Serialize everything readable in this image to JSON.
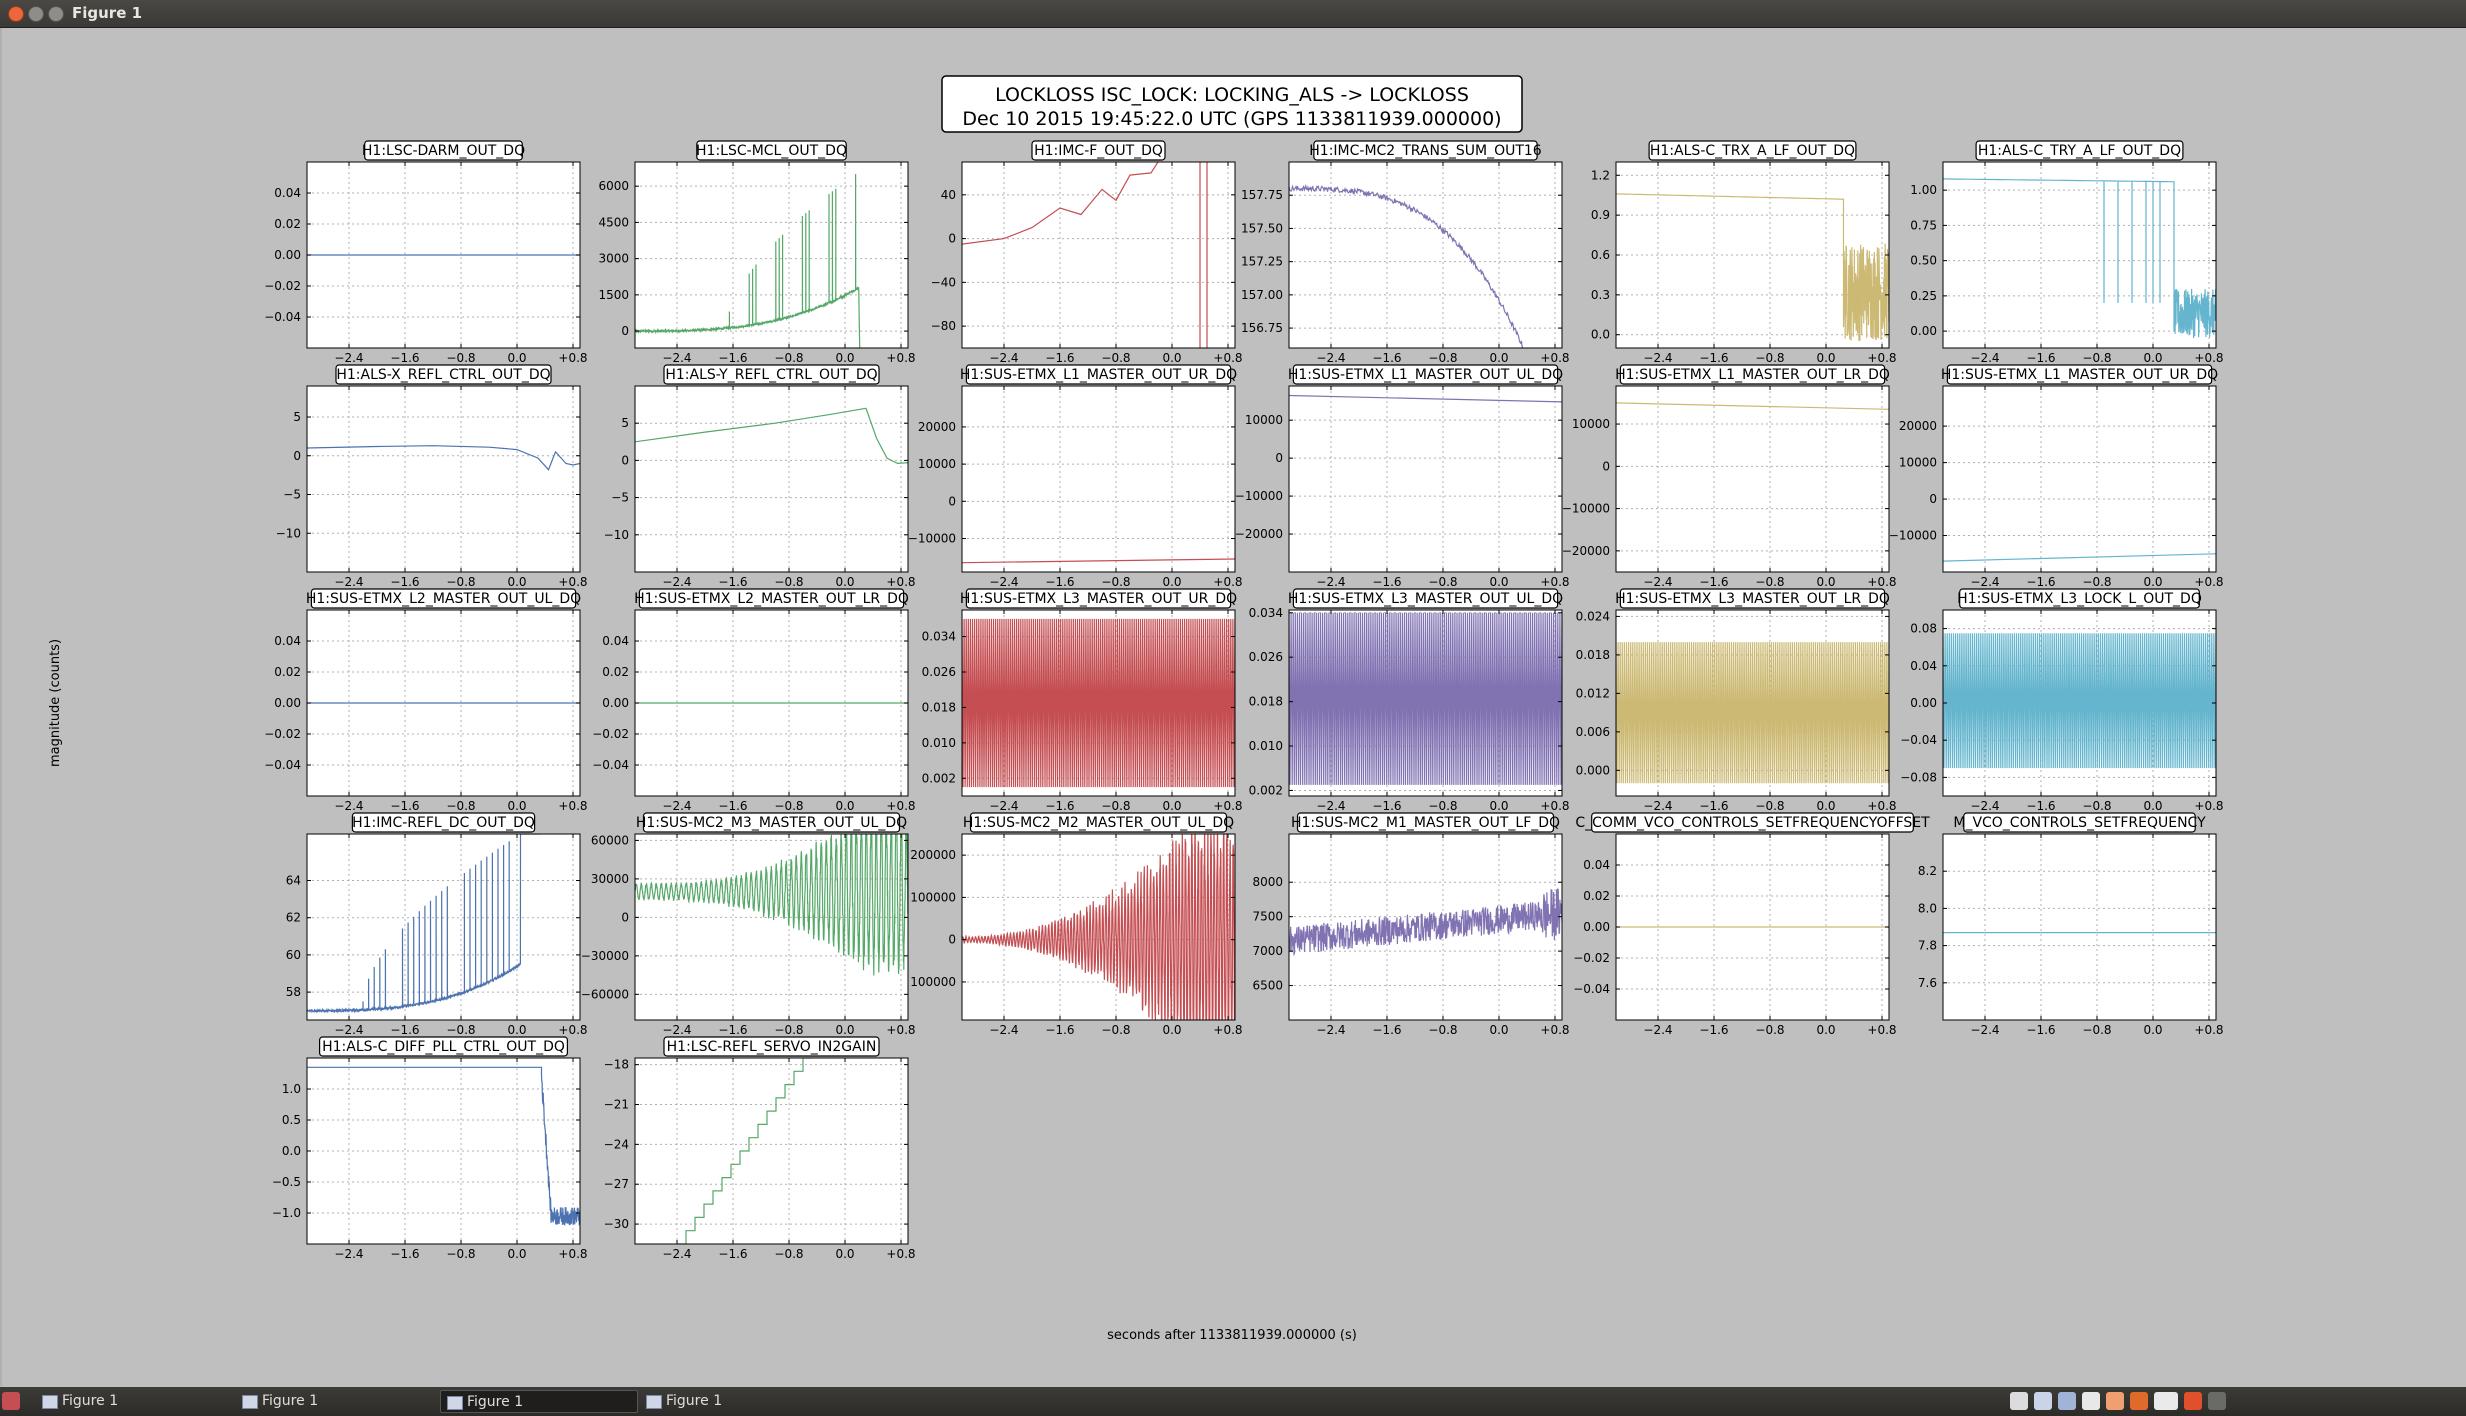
{
  "window": {
    "title": "Figure 1"
  },
  "figure": {
    "suptitle_line1": "LOCKLOSS ISC_LOCK: LOCKING_ALS -> LOCKLOSS",
    "suptitle_line2": "Dec 10 2015 19:45:22.0 UTC (GPS 1133811939.000000)",
    "xlabel": "seconds after 1133811939.000000 (s)",
    "ylabel": "magnitude (counts)"
  },
  "taskbar": {
    "items": [
      {
        "label": "Figure 1",
        "active": false
      },
      {
        "label": "Figure 1",
        "active": false
      },
      {
        "label": "Figure 1",
        "active": true
      },
      {
        "label": "Figure 1",
        "active": false
      }
    ]
  },
  "colors": {
    "blue": "#4c72b0",
    "green": "#55a868",
    "red": "#c44e52",
    "purple": "#8172b2",
    "gold": "#ccb974",
    "cyan": "#64b5cd",
    "background": "#bfbfbf"
  },
  "chart_data": [
    {
      "type": "line",
      "title": "H1:LSC-DARM_OUT_DQ",
      "color": "#4c72b0",
      "xlim": [
        -3.0,
        0.9
      ],
      "xticks": [
        -2.4,
        -1.6,
        -0.8,
        0.0,
        0.8
      ],
      "ylim": [
        -0.06,
        0.06
      ],
      "yticks": [
        0.04,
        0.02,
        0.0,
        -0.02,
        -0.04
      ],
      "yticklabels": [
        "0.04",
        "0.02",
        "0.00",
        "−0.02",
        "−0.04"
      ],
      "shape": "flat",
      "params": {
        "y": 0.0
      }
    },
    {
      "type": "line",
      "title": "H1:LSC-MCL_OUT_DQ",
      "color": "#55a868",
      "xlim": [
        -3.0,
        0.9
      ],
      "xticks": [
        -2.4,
        -1.6,
        -0.8,
        0.0,
        0.8
      ],
      "ylim": [
        -700,
        7000
      ],
      "yticks": [
        6000,
        4500,
        3000,
        1500,
        0
      ],
      "yticklabels": [
        "6000",
        "4500",
        "3000",
        "1500",
        "0"
      ],
      "shape": "spiky",
      "params": {
        "base0": 0,
        "base1": 1800,
        "peak0": 100,
        "peak1": 6600,
        "n": 40,
        "start": -1.7,
        "end": 0.2,
        "drop": -700,
        "noise": 80
      }
    },
    {
      "type": "line",
      "title": "H1:IMC-F_OUT_DQ",
      "color": "#c44e52",
      "xlim": [
        -3.0,
        0.9
      ],
      "xticks": [
        -2.4,
        -1.6,
        -0.8,
        0.0,
        0.8
      ],
      "ylim": [
        -100,
        70
      ],
      "yticks": [
        40,
        0,
        -40,
        -80
      ],
      "yticklabels": [
        "40",
        "0",
        "−40",
        "−80"
      ],
      "shape": "poly",
      "params": {
        "pts": [
          [
            -3.0,
            -5
          ],
          [
            -2.4,
            0
          ],
          [
            -2.0,
            10
          ],
          [
            -1.6,
            28
          ],
          [
            -1.3,
            22
          ],
          [
            -1.0,
            45
          ],
          [
            -0.8,
            35
          ],
          [
            -0.6,
            58
          ],
          [
            -0.3,
            60
          ],
          [
            -0.15,
            75
          ]
        ],
        "vlines": [
          0.4,
          0.5
        ]
      }
    },
    {
      "type": "line",
      "title": "H1:IMC-MC2_TRANS_SUM_OUT16",
      "color": "#8172b2",
      "xlim": [
        -3.0,
        0.9
      ],
      "xticks": [
        -2.4,
        -1.6,
        -0.8,
        0.0,
        0.8
      ],
      "ylim": [
        156.6,
        158.0
      ],
      "yticks": [
        157.75,
        157.5,
        157.25,
        157.0,
        156.75
      ],
      "yticklabels": [
        "157.75",
        "157.50",
        "157.25",
        "157.00",
        "156.75"
      ],
      "shape": "decay",
      "params": {
        "start": 157.8,
        "end": 156.6,
        "tend": 0.35,
        "noise": 0.02
      }
    },
    {
      "type": "line",
      "title": "H1:ALS-C_TRX_A_LF_OUT_DQ",
      "color": "#ccb974",
      "xlim": [
        -3.0,
        0.9
      ],
      "xticks": [
        -2.4,
        -1.6,
        -0.8,
        0.0,
        0.8
      ],
      "ylim": [
        -0.1,
        1.3
      ],
      "yticks": [
        1.2,
        0.9,
        0.6,
        0.3,
        0.0
      ],
      "yticklabels": [
        "1.2",
        "0.9",
        "0.6",
        "0.3",
        "0.0"
      ],
      "shape": "steptonoise",
      "params": {
        "level": 1.06,
        "level2": 1.02,
        "tstep": 0.25,
        "nlo": -0.05,
        "nhi": 0.7
      }
    },
    {
      "type": "line",
      "title": "H1:ALS-C_TRY_A_LF_OUT_DQ",
      "color": "#64b5cd",
      "xlim": [
        -3.0,
        0.9
      ],
      "xticks": [
        -2.4,
        -1.6,
        -0.8,
        0.0,
        0.8
      ],
      "ylim": [
        -0.12,
        1.2
      ],
      "yticks": [
        1.0,
        0.75,
        0.5,
        0.25,
        0.0
      ],
      "yticklabels": [
        "1.00",
        "0.75",
        "0.50",
        "0.25",
        "0.00"
      ],
      "shape": "steptonoise",
      "params": {
        "level": 1.08,
        "level2": 1.06,
        "tstep": 0.3,
        "nlo": -0.05,
        "nhi": 0.3,
        "spikes": [
          -0.7,
          -0.5,
          -0.3,
          -0.1,
          0.0,
          0.1
        ]
      }
    },
    {
      "type": "line",
      "title": "H1:ALS-X_REFL_CTRL_OUT_DQ",
      "color": "#4c72b0",
      "xlim": [
        -3.0,
        0.9
      ],
      "xticks": [
        -2.4,
        -1.6,
        -0.8,
        0.0,
        0.8
      ],
      "ylim": [
        -15,
        9
      ],
      "yticks": [
        5,
        0,
        -5,
        -10
      ],
      "yticklabels": [
        "5",
        "0",
        "−5",
        "−10"
      ],
      "shape": "poly",
      "params": {
        "pts": [
          [
            -3.0,
            1
          ],
          [
            -2.0,
            1.2
          ],
          [
            -1.2,
            1.3
          ],
          [
            -0.4,
            1.1
          ],
          [
            0.0,
            0.8
          ],
          [
            0.3,
            -0.3
          ],
          [
            0.45,
            -1.8
          ],
          [
            0.55,
            0.5
          ],
          [
            0.7,
            -1
          ],
          [
            0.8,
            -1.2
          ],
          [
            0.9,
            -1.0
          ]
        ]
      }
    },
    {
      "type": "line",
      "title": "H1:ALS-Y_REFL_CTRL_OUT_DQ",
      "color": "#55a868",
      "xlim": [
        -3.0,
        0.9
      ],
      "xticks": [
        -2.4,
        -1.6,
        -0.8,
        0.0,
        0.8
      ],
      "ylim": [
        -15,
        10
      ],
      "yticks": [
        5,
        0,
        -5,
        -10
      ],
      "yticklabels": [
        "5",
        "0",
        "−5",
        "−10"
      ],
      "shape": "poly",
      "params": {
        "pts": [
          [
            -3.0,
            2.5
          ],
          [
            -2.0,
            3.8
          ],
          [
            -1.0,
            5
          ],
          [
            -0.2,
            6.2
          ],
          [
            0.3,
            7
          ],
          [
            0.45,
            3
          ],
          [
            0.6,
            0.3
          ],
          [
            0.75,
            -0.4
          ],
          [
            0.9,
            -0.3
          ]
        ]
      }
    },
    {
      "type": "line",
      "title": "H1:SUS-ETMX_L1_MASTER_OUT_UR_DQ",
      "color": "#c44e52",
      "xlim": [
        -3.0,
        0.9
      ],
      "xticks": [
        -2.4,
        -1.6,
        -0.8,
        0.0,
        0.8
      ],
      "ylim": [
        -19000,
        31000
      ],
      "yticks": [
        20000,
        10000,
        0,
        -10000
      ],
      "yticklabels": [
        "20000",
        "10000",
        "0",
        "−10000"
      ],
      "shape": "linear",
      "params": {
        "y0": -16500,
        "y1": -15500
      }
    },
    {
      "type": "line",
      "title": "H1:SUS-ETMX_L1_MASTER_OUT_UL_DQ",
      "color": "#8172b2",
      "xlim": [
        -3.0,
        0.9
      ],
      "xticks": [
        -2.4,
        -1.6,
        -0.8,
        0.0,
        0.8
      ],
      "ylim": [
        -30000,
        19000
      ],
      "yticks": [
        10000,
        0,
        -10000,
        -20000
      ],
      "yticklabels": [
        "10000",
        "0",
        "−10000",
        "−20000"
      ],
      "shape": "linear",
      "params": {
        "y0": 16500,
        "y1": 14800
      }
    },
    {
      "type": "line",
      "title": "H1:SUS-ETMX_L1_MASTER_OUT_LR_DQ",
      "color": "#ccb974",
      "xlim": [
        -3.0,
        0.9
      ],
      "xticks": [
        -2.4,
        -1.6,
        -0.8,
        0.0,
        0.8
      ],
      "ylim": [
        -25000,
        19000
      ],
      "yticks": [
        10000,
        0,
        -10000,
        -20000
      ],
      "yticklabels": [
        "10000",
        "0",
        "−10000",
        "−20000"
      ],
      "shape": "linear",
      "params": {
        "y0": 15000,
        "y1": 13500
      }
    },
    {
      "type": "line",
      "title": "H1:SUS-ETMX_L1_MASTER_OUT_UR_DQ",
      "color": "#64b5cd",
      "xlim": [
        -3.0,
        0.9
      ],
      "xticks": [
        -2.4,
        -1.6,
        -0.8,
        0.0,
        0.8
      ],
      "ylim": [
        -20000,
        31000
      ],
      "yticks": [
        20000,
        10000,
        0,
        -10000
      ],
      "yticklabels": [
        "20000",
        "10000",
        "0",
        "−10000"
      ],
      "shape": "linear",
      "params": {
        "y0": -17000,
        "y1": -15000
      }
    },
    {
      "type": "line",
      "title": "H1:SUS-ETMX_L2_MASTER_OUT_UL_DQ",
      "color": "#4c72b0",
      "xlim": [
        -3.0,
        0.9
      ],
      "xticks": [
        -2.4,
        -1.6,
        -0.8,
        0.0,
        0.8
      ],
      "ylim": [
        -0.06,
        0.06
      ],
      "yticks": [
        0.04,
        0.02,
        0.0,
        -0.02,
        -0.04
      ],
      "yticklabels": [
        "0.04",
        "0.02",
        "0.00",
        "−0.02",
        "−0.04"
      ],
      "shape": "flat",
      "params": {
        "y": 0.0
      }
    },
    {
      "type": "line",
      "title": "H1:SUS-ETMX_L2_MASTER_OUT_LR_DQ",
      "color": "#55a868",
      "xlim": [
        -3.0,
        0.9
      ],
      "xticks": [
        -2.4,
        -1.6,
        -0.8,
        0.0,
        0.8
      ],
      "ylim": [
        -0.06,
        0.06
      ],
      "yticks": [
        0.04,
        0.02,
        0.0,
        -0.02,
        -0.04
      ],
      "yticklabels": [
        "0.04",
        "0.02",
        "0.00",
        "−0.02",
        "−0.04"
      ],
      "shape": "flat",
      "params": {
        "y": 0.0
      }
    },
    {
      "type": "line",
      "title": "H1:SUS-ETMX_L3_MASTER_OUT_UR_DQ",
      "color": "#c44e52",
      "xlim": [
        -3.0,
        0.9
      ],
      "xticks": [
        -2.4,
        -1.6,
        -0.8,
        0.0,
        0.8
      ],
      "ylim": [
        -0.002,
        0.04
      ],
      "yticks": [
        0.034,
        0.026,
        0.018,
        0.01,
        0.002
      ],
      "yticklabels": [
        "0.034",
        "0.026",
        "0.018",
        "0.010",
        "0.002"
      ],
      "shape": "band",
      "params": {
        "lo": 0.0,
        "hi": 0.038
      }
    },
    {
      "type": "line",
      "title": "H1:SUS-ETMX_L3_MASTER_OUT_UL_DQ",
      "color": "#8172b2",
      "xlim": [
        -3.0,
        0.9
      ],
      "xticks": [
        -2.4,
        -1.6,
        -0.8,
        0.0,
        0.8
      ],
      "ylim": [
        0.001,
        0.0345
      ],
      "yticks": [
        0.034,
        0.026,
        0.018,
        0.01,
        0.002
      ],
      "yticklabels": [
        "0.034",
        "0.026",
        "0.018",
        "0.010",
        "0.002"
      ],
      "shape": "band",
      "params": {
        "lo": 0.003,
        "hi": 0.034
      }
    },
    {
      "type": "line",
      "title": "H1:SUS-ETMX_L3_MASTER_OUT_LR_DQ",
      "color": "#ccb974",
      "xlim": [
        -3.0,
        0.9
      ],
      "xticks": [
        -2.4,
        -1.6,
        -0.8,
        0.0,
        0.8
      ],
      "ylim": [
        -0.004,
        0.025
      ],
      "yticks": [
        0.024,
        0.018,
        0.012,
        0.006,
        0.0
      ],
      "yticklabels": [
        "0.024",
        "0.018",
        "0.012",
        "0.006",
        "0.000"
      ],
      "shape": "band",
      "params": {
        "lo": -0.002,
        "hi": 0.02
      }
    },
    {
      "type": "line",
      "title": "H1:SUS-ETMX_L3_LOCK_L_OUT_DQ",
      "color": "#64b5cd",
      "xlim": [
        -3.0,
        0.9
      ],
      "xticks": [
        -2.4,
        -1.6,
        -0.8,
        0.0,
        0.8
      ],
      "ylim": [
        -0.1,
        0.1
      ],
      "yticks": [
        0.08,
        0.04,
        0.0,
        -0.04,
        -0.08
      ],
      "yticklabels": [
        "0.08",
        "0.04",
        "0.00",
        "−0.04",
        "−0.08"
      ],
      "shape": "band",
      "params": {
        "lo": -0.07,
        "hi": 0.075
      }
    },
    {
      "type": "line",
      "title": "H1:IMC-REFL_DC_OUT_DQ",
      "color": "#4c72b0",
      "xlim": [
        -3.0,
        0.9
      ],
      "xticks": [
        -2.4,
        -1.6,
        -0.8,
        0.0,
        0.8
      ],
      "ylim": [
        56.5,
        66.5
      ],
      "yticks": [
        64,
        62,
        60,
        58
      ],
      "yticklabels": [
        "64",
        "62",
        "60",
        "58"
      ],
      "shape": "spiky",
      "params": {
        "base0": 57.0,
        "base1": 59.5,
        "peak0": 57.5,
        "peak1": 66.5,
        "n": 28,
        "start": -2.2,
        "end": 0.05,
        "noise": 0.12,
        "rise": [
          0.05,
          0.35,
          66.5
        ]
      }
    },
    {
      "type": "line",
      "title": "H1:SUS-MC2_M3_MASTER_OUT_UL_DQ",
      "color": "#55a868",
      "xlim": [
        -3.0,
        0.9
      ],
      "xticks": [
        -2.4,
        -1.6,
        -0.8,
        0.0,
        0.8
      ],
      "ylim": [
        -80000,
        65000
      ],
      "yticks": [
        60000,
        30000,
        0,
        -30000,
        -60000
      ],
      "yticklabels": [
        "60000",
        "30000",
        "0",
        "−30000",
        "−60000"
      ],
      "shape": "oscgrow",
      "params": {
        "center": 20000,
        "amp0": 6000,
        "amp1": 55000,
        "tstart": -2.6,
        "tend": 0.3,
        "freq": 14
      }
    },
    {
      "type": "line",
      "title": "H1:SUS-MC2_M2_MASTER_OUT_UL_DQ",
      "color": "#c44e52",
      "xlim": [
        -3.0,
        0.9
      ],
      "xticks": [
        -2.4,
        -1.6,
        -0.8,
        0.0,
        0.8
      ],
      "ylim": [
        -190000,
        250000
      ],
      "yticks": [
        200000,
        100000,
        0,
        -100000
      ],
      "yticklabels": [
        "200000",
        "100000",
        "0",
        "100000"
      ],
      "shape": "oscgrow",
      "params": {
        "center": 0,
        "amp0": 6000,
        "amp1": 240000,
        "tstart": -3.0,
        "tend": 0.25,
        "freq": 22
      }
    },
    {
      "type": "line",
      "title": "H1:SUS-MC2_M1_MASTER_OUT_LF_DQ",
      "color": "#8172b2",
      "xlim": [
        -3.0,
        0.9
      ],
      "xticks": [
        -2.4,
        -1.6,
        -0.8,
        0.0,
        0.8
      ],
      "ylim": [
        6000,
        8700
      ],
      "yticks": [
        8000,
        7500,
        7000,
        6500
      ],
      "yticklabels": [
        "8000",
        "7500",
        "7000",
        "6500"
      ],
      "shape": "noisy",
      "params": {
        "mean0": 7150,
        "mean1": 7550,
        "amp": 420,
        "burst": [
          0.6,
          0.9,
          8500
        ]
      }
    },
    {
      "type": "line",
      "title": "C_COMM_VCO_CONTROLS_SETFREQUENCYOFFSET",
      "color": "#ccb974",
      "xlim": [
        -3.0,
        0.9
      ],
      "xticks": [
        -2.4,
        -1.6,
        -0.8,
        0.0,
        0.8
      ],
      "ylim": [
        -0.06,
        0.06
      ],
      "yticks": [
        0.04,
        0.02,
        0.0,
        -0.02,
        -0.04
      ],
      "yticklabels": [
        "0.04",
        "0.02",
        "0.00",
        "−0.02",
        "−0.04"
      ],
      "shape": "flat",
      "params": {
        "y": 0.0
      }
    },
    {
      "type": "line",
      "title": "M_VCO_CONTROLS_SETFREQUENCY",
      "color": "#64b5cd",
      "xlim": [
        -3.0,
        0.9
      ],
      "xticks": [
        -2.4,
        -1.6,
        -0.8,
        0.0,
        0.8
      ],
      "ylim": [
        7.4,
        8.4
      ],
      "yticks": [
        8.2,
        8.0,
        7.8,
        7.6
      ],
      "yticklabels": [
        "8.2",
        "8.0",
        "7.8",
        "7.6"
      ],
      "shape": "flat",
      "params": {
        "y": 7.87
      }
    },
    {
      "type": "line",
      "title": "H1:ALS-C_DIFF_PLL_CTRL_OUT_DQ",
      "color": "#4c72b0",
      "xlim": [
        -3.0,
        0.9
      ],
      "xticks": [
        -2.4,
        -1.6,
        -0.8,
        0.0,
        0.8
      ],
      "ylim": [
        -1.5,
        1.5
      ],
      "yticks": [
        1.0,
        0.5,
        0.0,
        -0.5,
        -1.0
      ],
      "yticklabels": [
        "1.0",
        "0.5",
        "0.0",
        "−0.5",
        "−1.0"
      ],
      "shape": "steptonoise",
      "params": {
        "level": 1.35,
        "level2": 1.35,
        "tstep": 0.35,
        "nlo": -1.25,
        "nhi": -0.9,
        "decay": true
      }
    },
    {
      "type": "line",
      "title": "H1:LSC-REFL_SERVO_IN2GAIN",
      "color": "#55a868",
      "xlim": [
        -3.0,
        0.9
      ],
      "xticks": [
        -2.4,
        -1.6,
        -0.8,
        0.0,
        0.8
      ],
      "ylim": [
        -31.5,
        -17.5
      ],
      "yticks": [
        -18,
        -21,
        -24,
        -27,
        -30
      ],
      "yticklabels": [
        "−18",
        "−21",
        "−24",
        "−27",
        "−30"
      ],
      "shape": "stairs",
      "params": {
        "t0": -2.4,
        "t1": -0.6,
        "y0": -31.5,
        "y1": -17.5,
        "steps": 14
      }
    }
  ]
}
